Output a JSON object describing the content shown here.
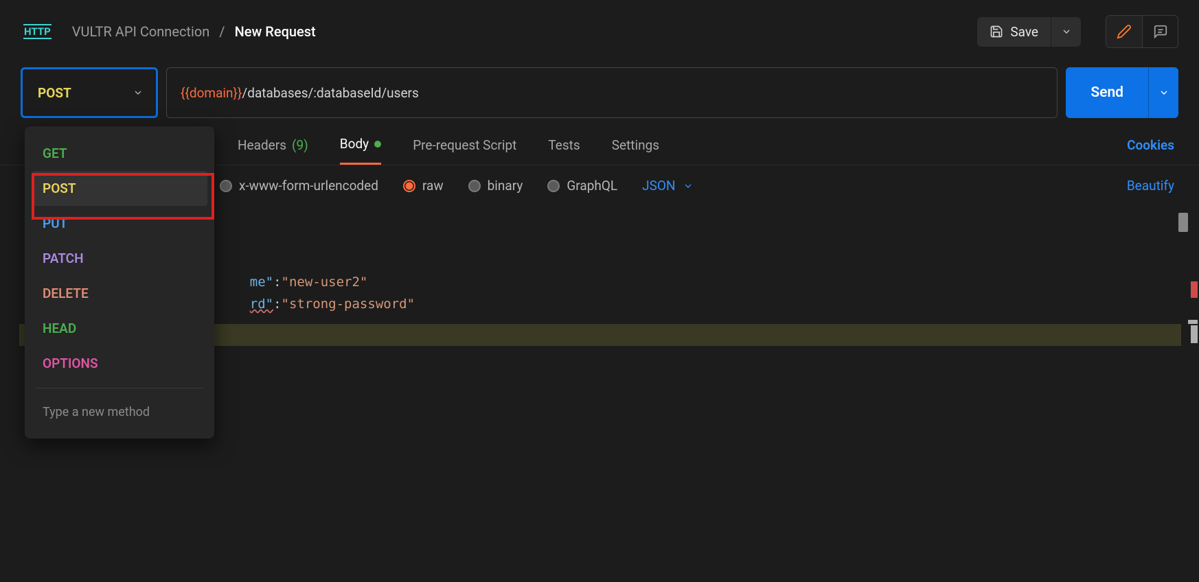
{
  "header": {
    "http_badge": "HTTP",
    "breadcrumb_parent": "VULTR API Connection",
    "breadcrumb_sep": "/",
    "breadcrumb_current": "New Request",
    "save_label": "Save"
  },
  "request": {
    "method": "POST",
    "url_variable": "{{domain}}",
    "url_path": "/databases/:databaseId/users",
    "send_label": "Send"
  },
  "tabs": {
    "headers_label": "Headers",
    "headers_count": "(9)",
    "body_label": "Body",
    "prerequest_label": "Pre-request Script",
    "tests_label": "Tests",
    "settings_label": "Settings",
    "cookies_label": "Cookies"
  },
  "body_types": {
    "xwww": "x-www-form-urlencoded",
    "raw": "raw",
    "binary": "binary",
    "graphql": "GraphQL",
    "json_label": "JSON",
    "beautify_label": "Beautify"
  },
  "editor": {
    "line2_key_frag": "me\"",
    "line2_colon": ":",
    "line2_value": "\"new-user2\"",
    "line3_key_frag": "rd\"",
    "line3_colon": ":",
    "line3_value": "\"strong-password\""
  },
  "method_dropdown": {
    "get": "GET",
    "post": "POST",
    "put": "PUT",
    "patch": "PATCH",
    "delete": "DELETE",
    "head": "HEAD",
    "options": "OPTIONS",
    "new_placeholder": "Type a new method"
  }
}
